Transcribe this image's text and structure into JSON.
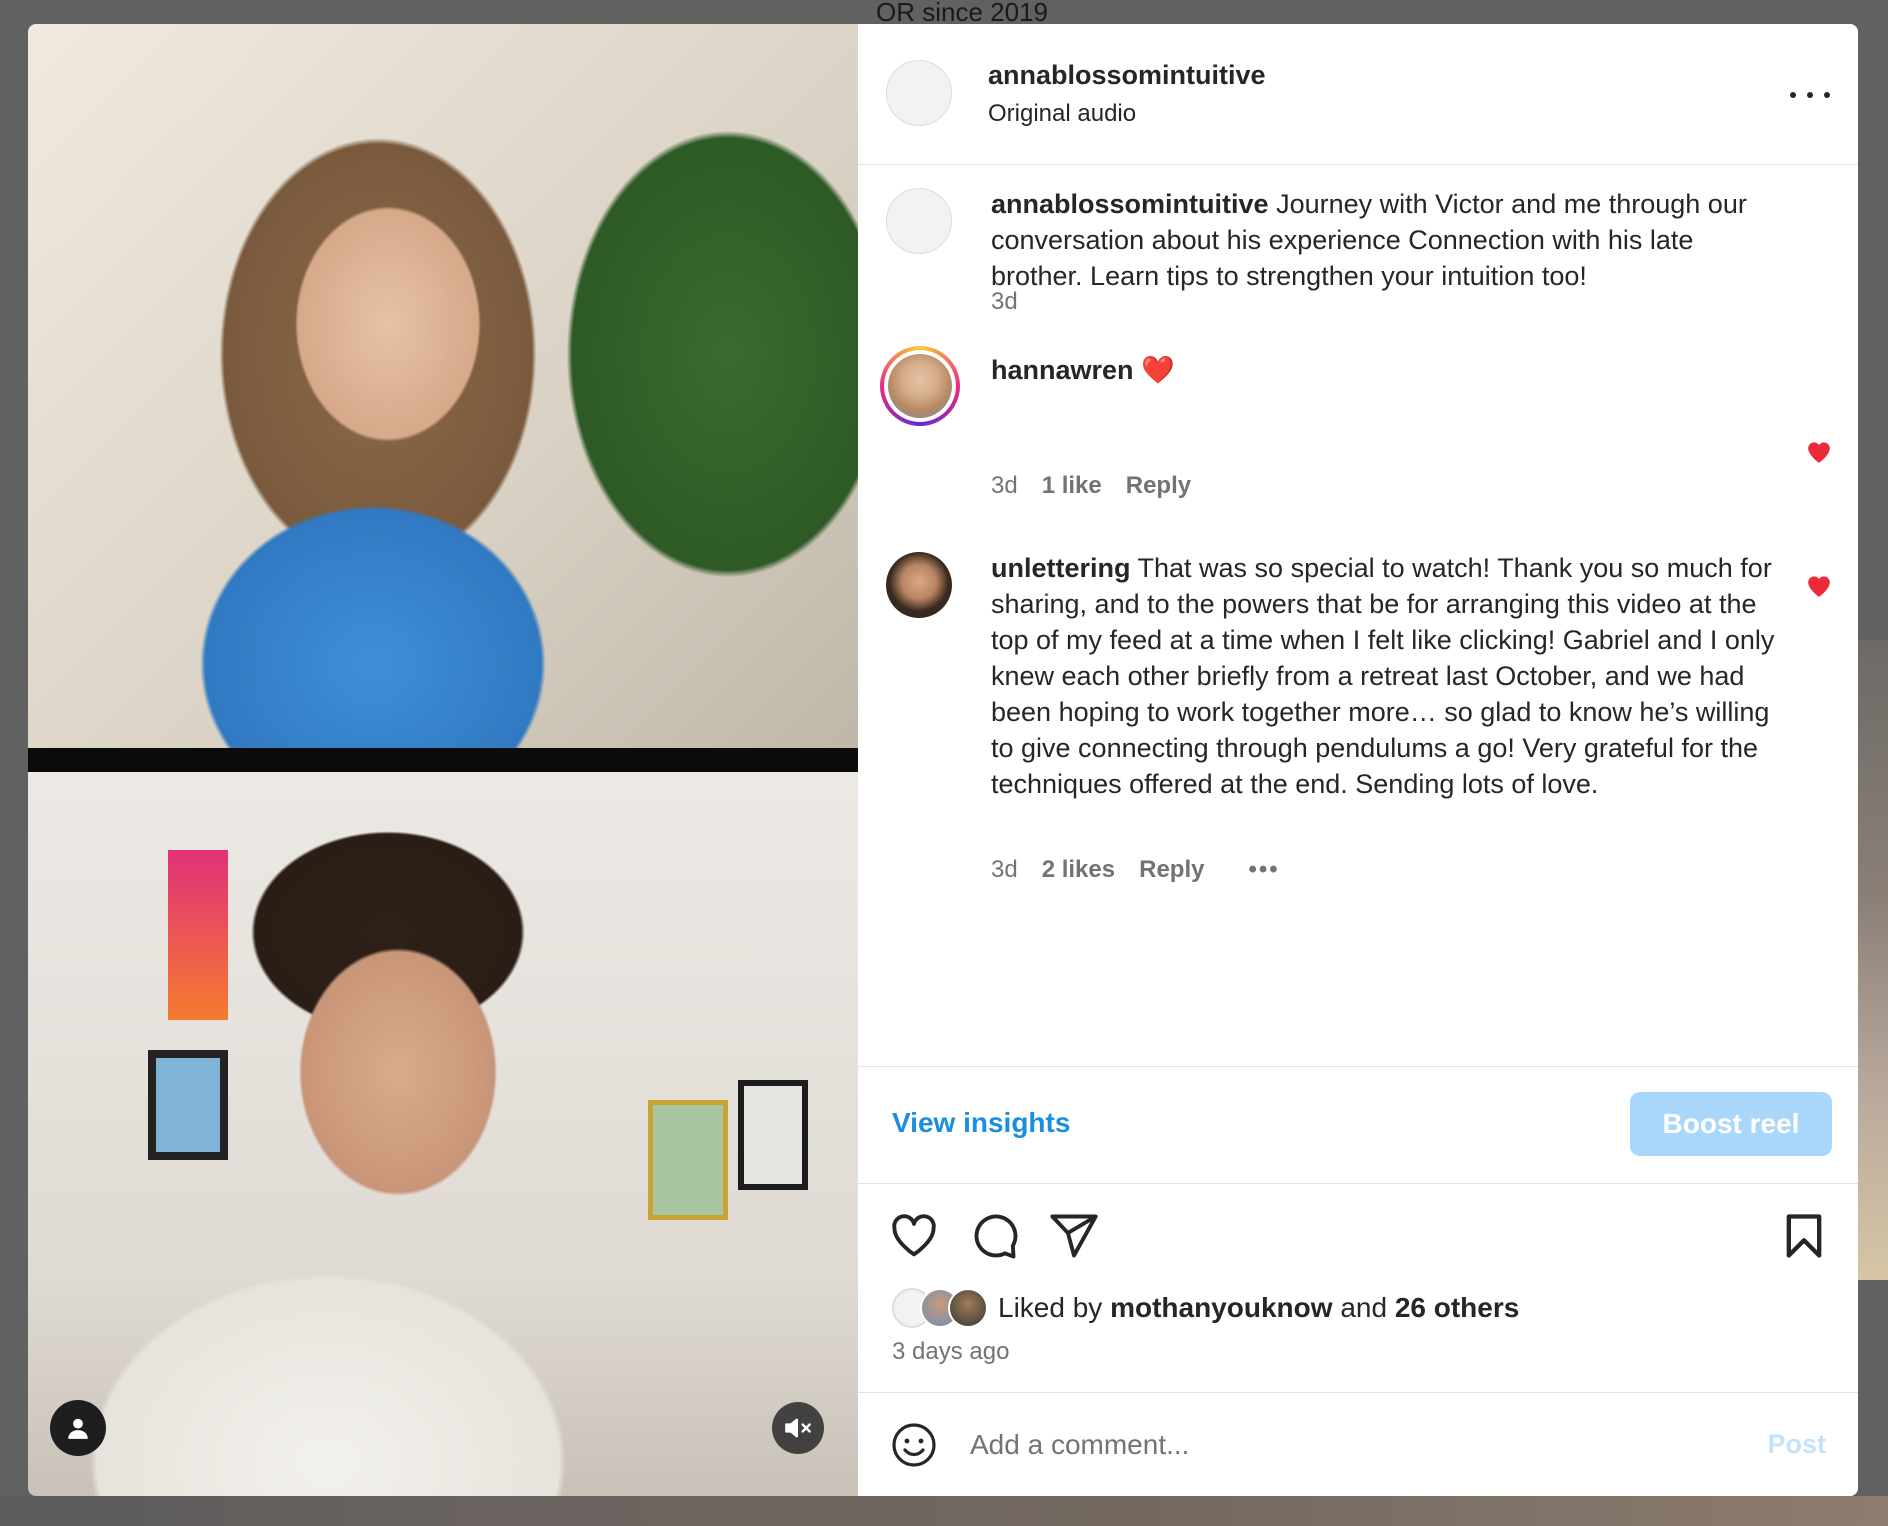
{
  "background": {
    "strip_text": "OR since 2019"
  },
  "reel": {
    "author": "annablossomintuitive",
    "audio": "Original audio",
    "caption": {
      "user": "annablossomintuitive",
      "text": "Journey with Victor and me through our conversation about his experience Connection with his late brother. Learn tips to strengthen your intuition too!",
      "time": "3d"
    }
  },
  "comments": [
    {
      "user": "hannawren",
      "text": "❤️",
      "time": "3d",
      "likes": "1 like",
      "reply": "Reply",
      "liked": true
    },
    {
      "user": "unlettering",
      "text": "That was so special to watch! Thank you so much for sharing, and to the powers that be for arranging this video at the top of my feed at a time when I felt like clicking! Gabriel and I only knew each other briefly from a retreat last October, and we had been hoping to work together more… so glad to know he’s willing to give connecting through pendulums a go! Very grateful for the techniques offered at the end. Sending lots of love.",
      "time": "3d",
      "likes": "2 likes",
      "reply": "Reply",
      "more": "•••",
      "liked": true
    }
  ],
  "insights": {
    "view_label": "View insights",
    "boost_label": "Boost reel"
  },
  "likes": {
    "prefix": "Liked by",
    "user": "mothanyouknow",
    "and": "and",
    "others": "26 others"
  },
  "posted": "3 days ago",
  "add_comment": {
    "placeholder": "Add a comment...",
    "post_label": "Post"
  },
  "icons": [
    "user-icon",
    "mute-icon",
    "more-icon",
    "heart-icon",
    "comment-icon",
    "share-icon",
    "bookmark-icon",
    "emoji-icon"
  ],
  "colors": {
    "link": "#1a8fe0",
    "boost_bg": "#a9d7fb",
    "heart": "#ed2a3a",
    "post_disabled": "#c3e3fc"
  }
}
